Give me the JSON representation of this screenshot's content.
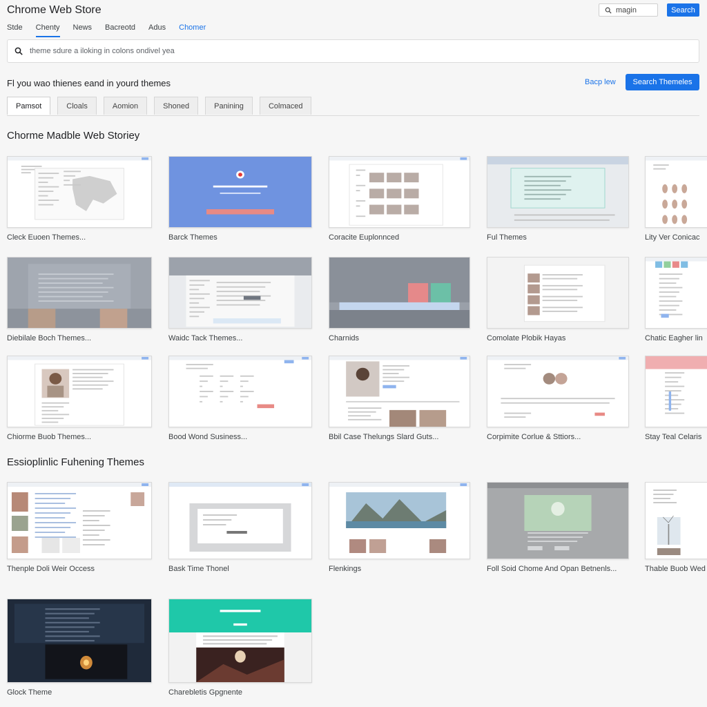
{
  "header": {
    "app_title": "Chrome Web Store",
    "signin_label": "magin",
    "search_label": "Search"
  },
  "nav": [
    {
      "label": "Stde",
      "style": "plain"
    },
    {
      "label": "Chenty",
      "style": "active"
    },
    {
      "label": "News",
      "style": "plain"
    },
    {
      "label": "Bacreotd",
      "style": "plain"
    },
    {
      "label": "Adus",
      "style": "plain"
    },
    {
      "label": "Chomer",
      "style": "link"
    }
  ],
  "search": {
    "value": "theme sdure a iloking in colons ondivel yea"
  },
  "section": {
    "heading": "Fl you wao thienes eand in yourd themes",
    "link_label": "Bacp lew",
    "button_label": "Search Themeles"
  },
  "filters": [
    "Pamsot",
    "Cloals",
    "Aomion",
    "Shoned",
    "Panining",
    "Colmaced"
  ],
  "groups": [
    {
      "title": "Chorme Madble Web Storiey",
      "cards": [
        {
          "label": "Cleck Euoen Themes...",
          "style": "map"
        },
        {
          "label": "Barck Themes",
          "style": "blue"
        },
        {
          "label": "Coracite Euplonnced",
          "style": "grid-photos"
        },
        {
          "label": "Ful Themes",
          "style": "teal-panel"
        },
        {
          "label": "Lity Ver Conicac",
          "style": "avatars"
        },
        {
          "label": "Diebilale Boch Themes...",
          "style": "gray-table"
        },
        {
          "label": "Waidc Tack Themes...",
          "style": "gray-form"
        },
        {
          "label": "Charnids",
          "style": "gray-blocks"
        },
        {
          "label": "Comolate Plobik Hayas",
          "style": "white-list"
        },
        {
          "label": "Chatic Eagher lin",
          "style": "color-tabs"
        },
        {
          "label": "Chiorme Buob Themes...",
          "style": "profile"
        },
        {
          "label": "Bood Wond Susiness...",
          "style": "form-cols"
        },
        {
          "label": "Bbil Case Thelungs Slard Guts...",
          "style": "person-card"
        },
        {
          "label": "Corpimite Corlue & Sttiors...",
          "style": "circles"
        },
        {
          "label": "Stay Teal Celaris",
          "style": "pink-head"
        }
      ]
    },
    {
      "title": "Essioplinlic Fuhening Themes",
      "cards": [
        {
          "label": "Thenple Doli Weir Occess",
          "style": "thumbs-left"
        },
        {
          "label": "Bask Time Thonel",
          "style": "window"
        },
        {
          "label": "Flenkings",
          "style": "landscape"
        },
        {
          "label": "Foll Soid Chome And Opan Betnenls...",
          "style": "gray-green"
        },
        {
          "label": "Thable Buob Wed",
          "style": "windmill"
        },
        {
          "label": "Glock Theme",
          "style": "dark"
        },
        {
          "label": "Charebletis Gpgnente",
          "style": "teal-dark"
        }
      ]
    }
  ],
  "colors": {
    "accent": "#1a73e8",
    "teal": "#1fc8a9",
    "dark_navy": "#1f2a3a",
    "soft_blue": "#6f93e0",
    "coral": "#e88a85"
  }
}
